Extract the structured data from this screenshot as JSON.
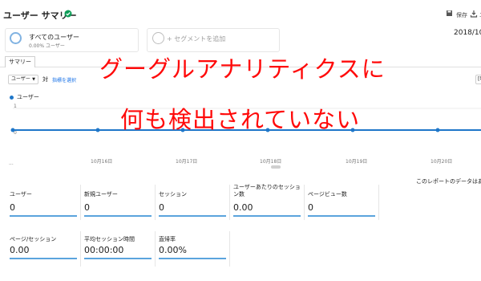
{
  "header": {
    "title": "ユーザー サマリー",
    "save_label": "保存",
    "export_label": "エ"
  },
  "segments": {
    "active_title": "すべてのユーザー",
    "active_sub": "0.00% ユーザー",
    "add_label": "+ セグメントを追加"
  },
  "date_range": "2018/10/",
  "tabs": {
    "summary": "サマリー"
  },
  "metric_selector": {
    "selected": "ユーザー",
    "vs": "対",
    "select_metric": "指標を選択",
    "right_cut": "[時"
  },
  "chart_data": {
    "type": "line",
    "series": [
      {
        "name": "ユーザー",
        "values": [
          0,
          0,
          0,
          0,
          0,
          0
        ]
      }
    ],
    "y_ticks": [
      "1",
      "0"
    ],
    "x_ticks": [
      "10月16日",
      "10月17日",
      "10月18日",
      "10月19日",
      "10月20日"
    ],
    "ylim": [
      0,
      1
    ],
    "color": "#1f77c9"
  },
  "chart_more": "...",
  "report_note": "このレポートのデータはあり",
  "metrics_row1": [
    {
      "label": "ユーザー",
      "value": "0"
    },
    {
      "label": "新規ユーザー",
      "value": "0"
    },
    {
      "label": "セッション",
      "value": "0"
    },
    {
      "label": "ユーザーあたりのセッション数",
      "value": "0.00"
    },
    {
      "label": "ページビュー数",
      "value": "0"
    }
  ],
  "metrics_row2": [
    {
      "label": "ページ/セッション",
      "value": "0.00"
    },
    {
      "label": "平均セッション時間",
      "value": "00:00:00"
    },
    {
      "label": "直帰率",
      "value": "0.00%"
    }
  ],
  "overlay": {
    "line1": "グーグルアナリティクスに",
    "line2": "何も検出されていない"
  },
  "colors": {
    "accent": "#1f77c9",
    "overlay_text": "#ff0a0a",
    "verified": "#0f9d58"
  }
}
